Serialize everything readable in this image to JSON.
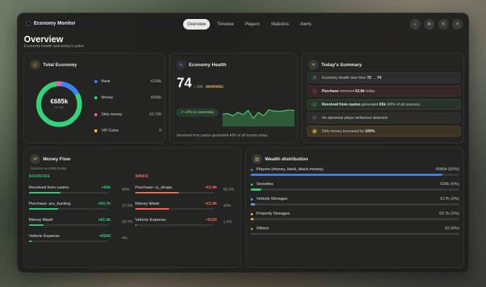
{
  "app": {
    "title": "Economy Monitor"
  },
  "tabs": [
    {
      "label": "Overview",
      "active": true
    },
    {
      "label": "Timeline"
    },
    {
      "label": "Players"
    },
    {
      "label": "Statistics"
    },
    {
      "label": "Alerts"
    }
  ],
  "toolbar_icons": [
    "sun-icon",
    "gear-icon",
    "refresh-icon",
    "close-icon"
  ],
  "overview": {
    "title": "Overview",
    "subtitle": "Economy health and today's pulse"
  },
  "total_economy": {
    "title": "Total Economy",
    "value": "€685k",
    "value_label": "TOTAL",
    "items": [
      {
        "label": "Bank",
        "value": "€126k",
        "color": "#3b82f6",
        "share": 0.184
      },
      {
        "label": "Money",
        "value": "€555k",
        "color": "#34d27a",
        "share": 0.81
      },
      {
        "label": "Dirty money",
        "value": "€3,700",
        "color": "#f05ab0",
        "share": 0.0054
      },
      {
        "label": "VIP Coins",
        "value": "0",
        "color": "#f2c230",
        "share": 0
      }
    ]
  },
  "economy_health": {
    "title": "Economy Health",
    "score": "74",
    "scale": "/ 100 · ",
    "status": "WARNING",
    "change_chip": "+2% vs yesterday",
    "footnote": "Received from casino generated 40% of all income today.",
    "trend": [
      0.52,
      0.55,
      0.45,
      0.6,
      0.5,
      0.68,
      0.35,
      0.6,
      0.45,
      0.7,
      0.65,
      0.64,
      0.66,
      0.7,
      0.68
    ]
  },
  "summary": {
    "title": "Today's Summary",
    "rows": [
      {
        "type": "neutral",
        "icon": "trend-icon",
        "pre": "Economy Health rose from ",
        "b1": "72",
        "mid": " → ",
        "b2": "74",
        "post": ""
      },
      {
        "type": "red",
        "icon": "down-arrow-icon",
        "pre": "",
        "b1": "Purchase",
        "mid": " removed ",
        "b2": "€3.8k",
        "post": " today."
      },
      {
        "type": "green",
        "icon": "up-arrow-icon",
        "pre": "",
        "b1": "Received from casino",
        "mid": " generated ",
        "b2": "€5k",
        "post": " (40% of all sources)."
      },
      {
        "type": "neutral",
        "icon": "check-icon",
        "pre": "No abnormal player behaviour detected.",
        "b1": "",
        "mid": "",
        "b2": "",
        "post": ""
      },
      {
        "type": "gold",
        "icon": "wallet-icon",
        "pre": "Dirty money increased by ",
        "b1": "100%",
        "mid": ".",
        "b2": "",
        "post": ""
      }
    ]
  },
  "money_flow": {
    "title": "Money Flow",
    "subtitle": "Sources vs sinks today",
    "sources_label": "SOURCES",
    "sinks_label": "SINKS",
    "sources": [
      {
        "label": "Received from casino",
        "amount": "+€5k",
        "pct": "40%",
        "fill": 0.4
      },
      {
        "label": "Purchase: ars_hunting",
        "amount": "+€4.7k",
        "pct": "37.2%",
        "fill": 0.372
      },
      {
        "label": "Money Wash",
        "amount": "+€2.3k",
        "pct": "18.7%",
        "fill": 0.187
      },
      {
        "label": "Vehicle Expense",
        "amount": "+€500",
        "pct": "4%",
        "fill": 0.04
      }
    ],
    "sinks": [
      {
        "label": "Purchase: ry_shops",
        "amount": "−€3.8k",
        "pct": "55.5%",
        "fill": 0.555
      },
      {
        "label": "Money Wash",
        "amount": "−€2.9k",
        "pct": "43%",
        "fill": 0.43
      },
      {
        "label": "Vehicle Expense",
        "amount": "−€100",
        "pct": "1.5%",
        "fill": 0.015
      }
    ]
  },
  "wealth": {
    "title": "Wealth distribution",
    "rows": [
      {
        "label": "Players (money, bank, black money)",
        "value": "€685k (92%)",
        "color": "#3b82f6",
        "fill": 0.92
      },
      {
        "label": "Societies",
        "value": "€36k (5%)",
        "color": "#34d27a",
        "fill": 0.05
      },
      {
        "label": "Vehicle Storages",
        "value": "€17k (2%)",
        "color": "#6aa0ff",
        "fill": 0.02
      },
      {
        "label": "Property Storages",
        "value": "€3.7k (1%)",
        "color": "#f2c230",
        "fill": 0.01
      },
      {
        "label": "Others",
        "value": "€0 (0%)",
        "color": "#9a9a9a",
        "fill": 0
      }
    ]
  }
}
